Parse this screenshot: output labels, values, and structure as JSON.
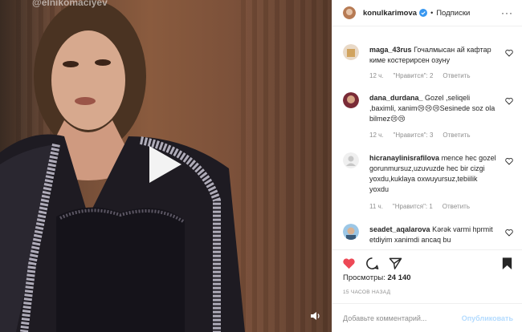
{
  "media": {
    "watermark": "@elnikomaciyev"
  },
  "header": {
    "username": "konulkarimova",
    "separator": "•",
    "follow_label": "Подписки",
    "more_label": "···"
  },
  "comments": [
    {
      "username": "maga_43rus",
      "text": "Гочалмысан ай кафтар киме костерирсен озуну",
      "time": "12 ч.",
      "likes": "\"Нравится\": 2",
      "reply": "Ответить"
    },
    {
      "username": "dana_durdana_",
      "text": "Gozel ,seliqeli ,baximli, xanim😢😢😢Sesinede soz ola bilmez😢😢",
      "time": "12 ч.",
      "likes": "\"Нравится\": 3",
      "reply": "Ответить"
    },
    {
      "username": "hicranaylinisrafilova",
      "text": "mence hec gozel gorunmursuz,uzuvuzde hec bir cizgi yoxdu,kuklaya oxwuyursuz,tebiilik yoxdu",
      "time": "11 ч.",
      "likes": "\"Нравится\": 1",
      "reply": "Ответить"
    },
    {
      "username": "seadet_aqalarova",
      "text": "Kərək varmi hprmit etdiyim xanimdi ancaq bu",
      "time": "",
      "likes": "",
      "reply": ""
    }
  ],
  "stats": {
    "views_label": "Просмотры:",
    "views_count": "24 140",
    "time_ago": "15 ЧАСОВ НАЗАД"
  },
  "comment_box": {
    "placeholder": "Добавьте комментарий...",
    "publish_label": "Опубликовать"
  },
  "colors": {
    "like_active": "#ed4956",
    "verified": "#3897f0",
    "publish_disabled": "#b3dbff",
    "meta_text": "#8e8e8e"
  },
  "icons": {
    "like": "heart-filled-icon",
    "comment": "comment-bubble-icon",
    "share": "paper-plane-icon",
    "save": "bookmark-filled-icon",
    "play": "play-icon",
    "audio": "speaker-icon",
    "verified": "verified-badge-icon"
  }
}
